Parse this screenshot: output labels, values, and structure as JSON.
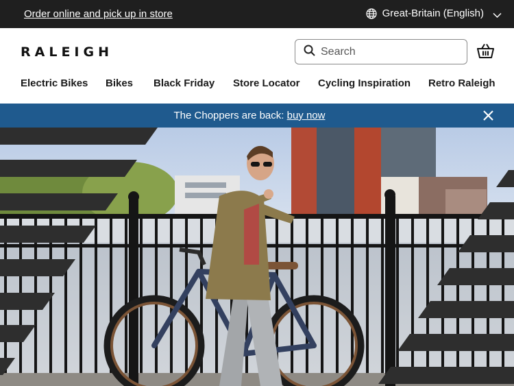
{
  "topbar": {
    "promo_link": "Order online and pick up in store",
    "region_label": "Great-Britain (English)",
    "region_icon": "globe-icon"
  },
  "header": {
    "logo_text": "RALEIGH",
    "search": {
      "placeholder": "Search"
    },
    "basket_icon": "basket-icon"
  },
  "nav": {
    "items": [
      {
        "label": "Electric Bikes"
      },
      {
        "label": "Bikes"
      },
      {
        "label": "Black Friday"
      },
      {
        "label": "Store Locator"
      },
      {
        "label": "Cycling Inspiration"
      },
      {
        "label": "Retro Raleigh"
      }
    ]
  },
  "banner": {
    "message": "The Choppers are back: ",
    "link": "buy now"
  },
  "colors": {
    "topbar_bg": "#1f1f1f",
    "banner_bg": "#1f5a8e",
    "stripe": "#2e2e2e"
  }
}
